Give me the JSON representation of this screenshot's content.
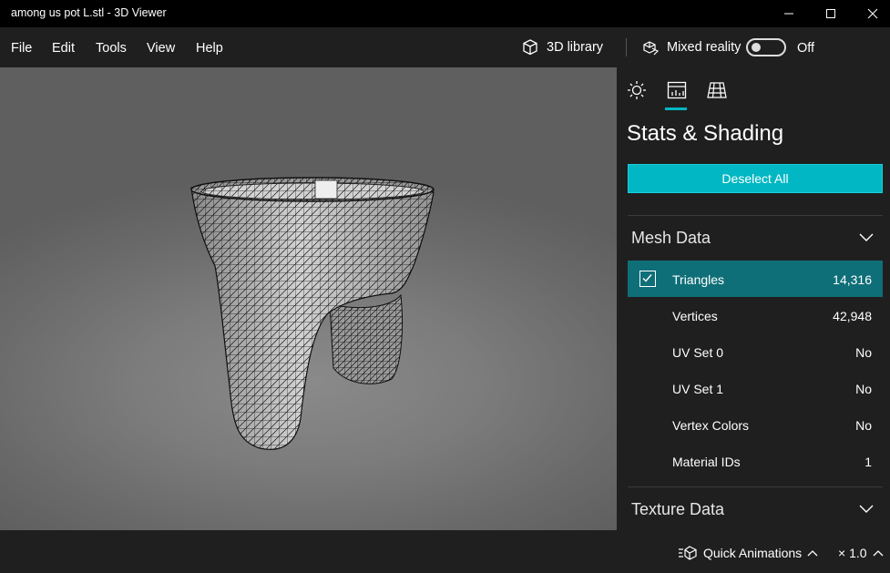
{
  "window": {
    "title": "among us pot L.stl - 3D Viewer"
  },
  "menu": {
    "items": [
      "File",
      "Edit",
      "Tools",
      "View",
      "Help"
    ],
    "library_label": "3D library",
    "mixed_reality_label": "Mixed reality",
    "toggle_state": "Off"
  },
  "panel": {
    "tabs": [
      "environment-icon",
      "stats-icon",
      "grid-icon"
    ],
    "title": "Stats & Shading",
    "deselect_label": "Deselect All",
    "mesh_section": "Mesh Data",
    "texture_section": "Texture Data",
    "rows": [
      {
        "label": "Triangles",
        "value": "14,316"
      },
      {
        "label": "Vertices",
        "value": "42,948"
      },
      {
        "label": "UV Set 0",
        "value": "No"
      },
      {
        "label": "UV Set 1",
        "value": "No"
      },
      {
        "label": "Vertex Colors",
        "value": "No"
      },
      {
        "label": "Material IDs",
        "value": "1"
      }
    ]
  },
  "bottom": {
    "animations_label": "Quick Animations",
    "speed_label": "× 1.0"
  },
  "colors": {
    "accent": "#00b7c3",
    "selected_row": "#0f6f78",
    "background": "#1f1f1f"
  }
}
